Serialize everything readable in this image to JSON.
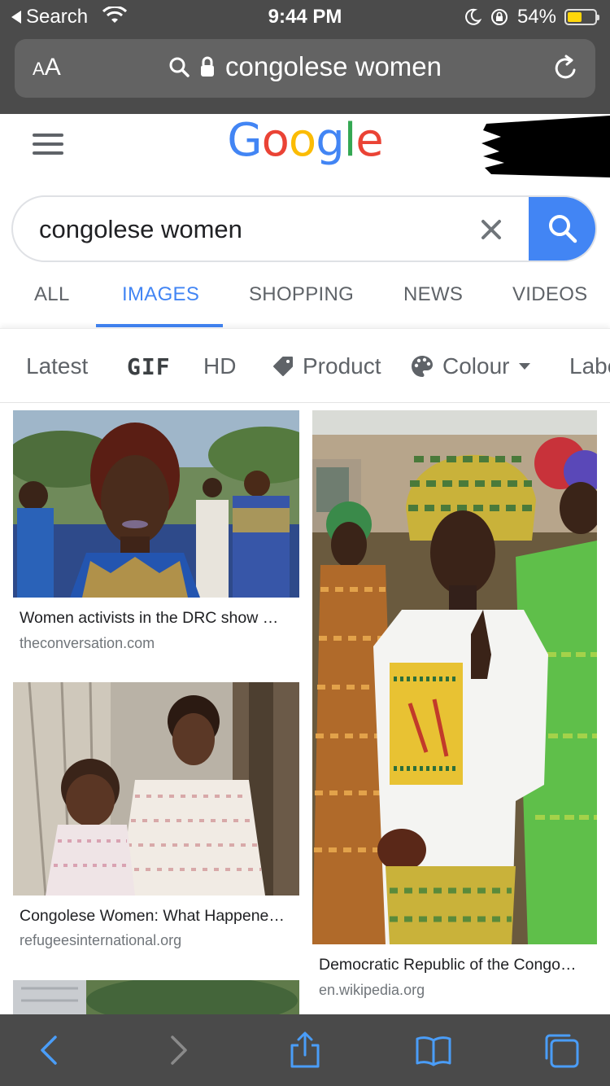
{
  "status_bar": {
    "back_label": "Search",
    "time": "9:44 PM",
    "battery_percent": "54%"
  },
  "address_bar": {
    "aa_label_small": "A",
    "aa_label_large": "A",
    "url_text": "congolese women"
  },
  "google": {
    "logo_letters": [
      "G",
      "o",
      "o",
      "g",
      "l",
      "e"
    ],
    "logo_colors": [
      "#4285f4",
      "#ea4335",
      "#fbbc05",
      "#4285f4",
      "#34a853",
      "#ea4335"
    ]
  },
  "search": {
    "query": "congolese women"
  },
  "tabs": [
    {
      "label": "ALL",
      "active": false
    },
    {
      "label": "IMAGES",
      "active": true
    },
    {
      "label": "SHOPPING",
      "active": false
    },
    {
      "label": "NEWS",
      "active": false
    },
    {
      "label": "VIDEOS",
      "active": false
    }
  ],
  "filters": [
    {
      "label": "Latest"
    },
    {
      "label": "GIF"
    },
    {
      "label": "HD"
    },
    {
      "label": "Product",
      "icon": "tag-icon"
    },
    {
      "label": "Colour",
      "icon": "palette-icon"
    },
    {
      "label": "Labe"
    }
  ],
  "results": [
    {
      "title": "Women activists in the DRC show …",
      "source": "theconversation.com"
    },
    {
      "title": "Congolese Women: What Happene…",
      "source": "refugeesinternational.org"
    },
    {
      "title": "Democratic Republic of the Congo…",
      "source": "en.wikipedia.org"
    }
  ],
  "colors": {
    "accent": "#4285f4",
    "safari_chrome": "#4b4b4b",
    "toolbar_icon": "#4a9df8"
  }
}
